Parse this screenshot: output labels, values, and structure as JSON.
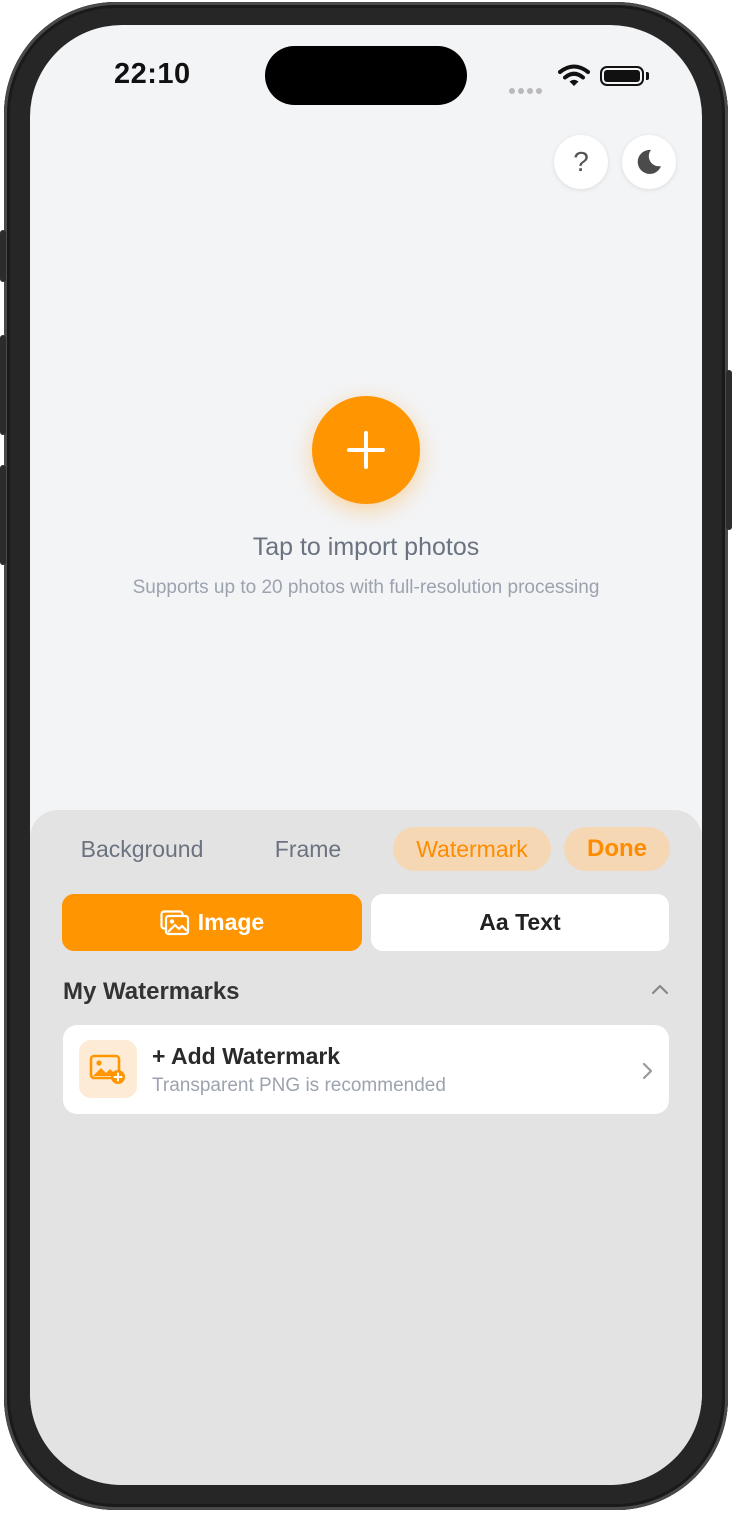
{
  "status_bar": {
    "time": "22:10"
  },
  "header": {
    "help_label": "?"
  },
  "empty_state": {
    "title": "Tap to import photos",
    "subtitle": "Supports up to 20 photos with full-resolution processing"
  },
  "tabs": [
    {
      "label": "Background"
    },
    {
      "label": "Frame"
    },
    {
      "label": "Watermark",
      "selected": true
    }
  ],
  "done_label": "Done",
  "segment": {
    "image_label": "Image",
    "text_label": "Aa Text",
    "selected": "Image"
  },
  "section": {
    "title": "My Watermarks"
  },
  "add_card": {
    "title": "+ Add Watermark",
    "subtitle": "Transparent PNG is recommended"
  },
  "colors": {
    "accent": "#ff9500",
    "accent_soft": "#f6d7b4",
    "background": "#f3f4f6",
    "panel": "#e3e3e3"
  },
  "icons": [
    "help-icon",
    "moon-icon",
    "plus-icon",
    "image-icon",
    "chevron-up-icon",
    "add-image-icon",
    "chevron-right-icon",
    "wifi-icon",
    "battery-icon"
  ]
}
